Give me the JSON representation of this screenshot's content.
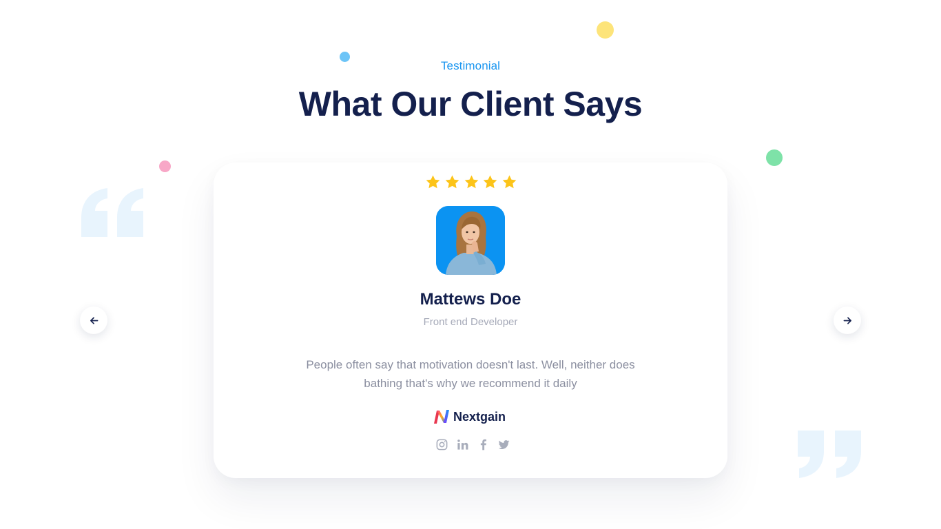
{
  "section": {
    "eyebrow": "Testimonial",
    "title": "What Our Client Says"
  },
  "testimonial": {
    "rating": 5,
    "rating_max": 5,
    "name": "Mattews Doe",
    "role": "Front end Developer",
    "quote": "People often say that motivation doesn't last. Well, neither does bathing that's why we recommend it daily",
    "company": "Nextgain",
    "socials": [
      "instagram-icon",
      "linkedin-icon",
      "facebook-icon",
      "twitter-icon"
    ]
  },
  "navigation": {
    "prev_icon": "arrow-left-icon",
    "next_icon": "arrow-right-icon"
  },
  "colors": {
    "accent": "#1a96f0",
    "heading": "#14204d",
    "star": "#fcc419",
    "avatar_bg": "#0b93f2",
    "muted_text": "#8b8fa0",
    "quote_mark": "#e8f4fd"
  }
}
